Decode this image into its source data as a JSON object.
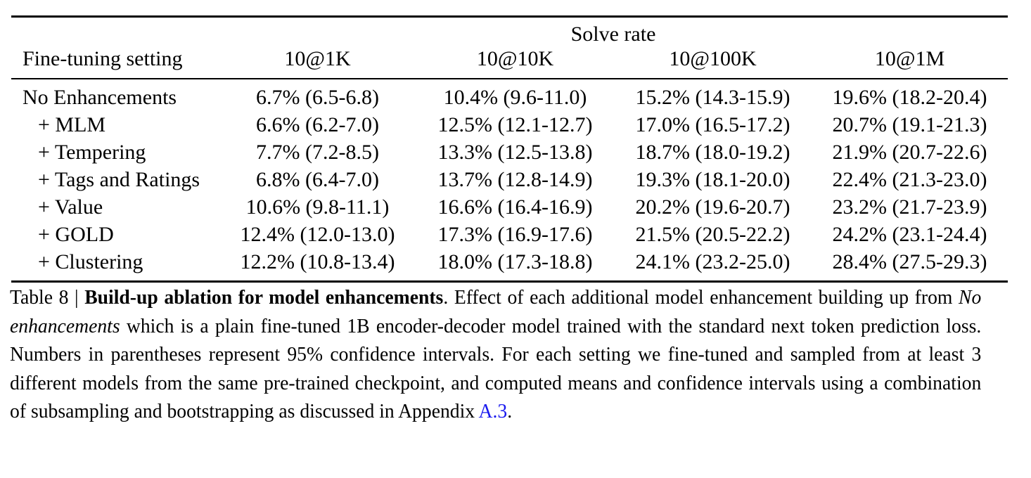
{
  "table": {
    "group_header": "Solve rate",
    "columns": [
      "Fine-tuning setting",
      "10@1K",
      "10@10K",
      "10@100K",
      "10@1M"
    ],
    "rows": [
      {
        "setting": "No Enhancements",
        "indented": false,
        "values": [
          "6.7% (6.5-6.8)",
          "10.4% (9.6-11.0)",
          "15.2% (14.3-15.9)",
          "19.6% (18.2-20.4)"
        ]
      },
      {
        "setting": "+ MLM",
        "indented": true,
        "values": [
          "6.6% (6.2-7.0)",
          "12.5% (12.1-12.7)",
          "17.0% (16.5-17.2)",
          "20.7% (19.1-21.3)"
        ]
      },
      {
        "setting": "+ Tempering",
        "indented": true,
        "values": [
          "7.7% (7.2-8.5)",
          "13.3% (12.5-13.8)",
          "18.7% (18.0-19.2)",
          "21.9% (20.7-22.6)"
        ]
      },
      {
        "setting": "+ Tags and Ratings",
        "indented": true,
        "values": [
          "6.8% (6.4-7.0)",
          "13.7% (12.8-14.9)",
          "19.3% (18.1-20.0)",
          "22.4% (21.3-23.0)"
        ]
      },
      {
        "setting": "+ Value",
        "indented": true,
        "values": [
          "10.6% (9.8-11.1)",
          "16.6% (16.4-16.9)",
          "20.2% (19.6-20.7)",
          "23.2% (21.7-23.9)"
        ]
      },
      {
        "setting": "+ GOLD",
        "indented": true,
        "values": [
          "12.4% (12.0-13.0)",
          "17.3% (16.9-17.6)",
          "21.5% (20.5-22.2)",
          "24.2% (23.1-24.4)"
        ]
      },
      {
        "setting": "+ Clustering",
        "indented": true,
        "values": [
          "12.2% (10.8-13.4)",
          "18.0% (17.3-18.8)",
          "24.1% (23.2-25.0)",
          "28.4% (27.5-29.3)"
        ]
      }
    ]
  },
  "caption": {
    "label": "Table 8 | ",
    "title": "Build-up ablation for model enhancements",
    "after_title": ". Effect of each additional model enhancement building up from ",
    "italic_phrase": "No enhancements",
    "body_part_1": " which is a plain fine-tuned 1B encoder-decoder model trained with the standard next token prediction loss. Numbers in parentheses represent 95% confidence intervals. For each setting we fine-tuned and sampled from at least 3 different models from the same pre-trained checkpoint, and computed means and confidence intervals using a combination of subsampling and bootstrapping as discussed in Appendix ",
    "link_text": "A.3",
    "body_part_2": "."
  },
  "colors": {
    "text": "#000000",
    "link": "#1a1aee",
    "rule": "#000000",
    "background": "#ffffff"
  }
}
